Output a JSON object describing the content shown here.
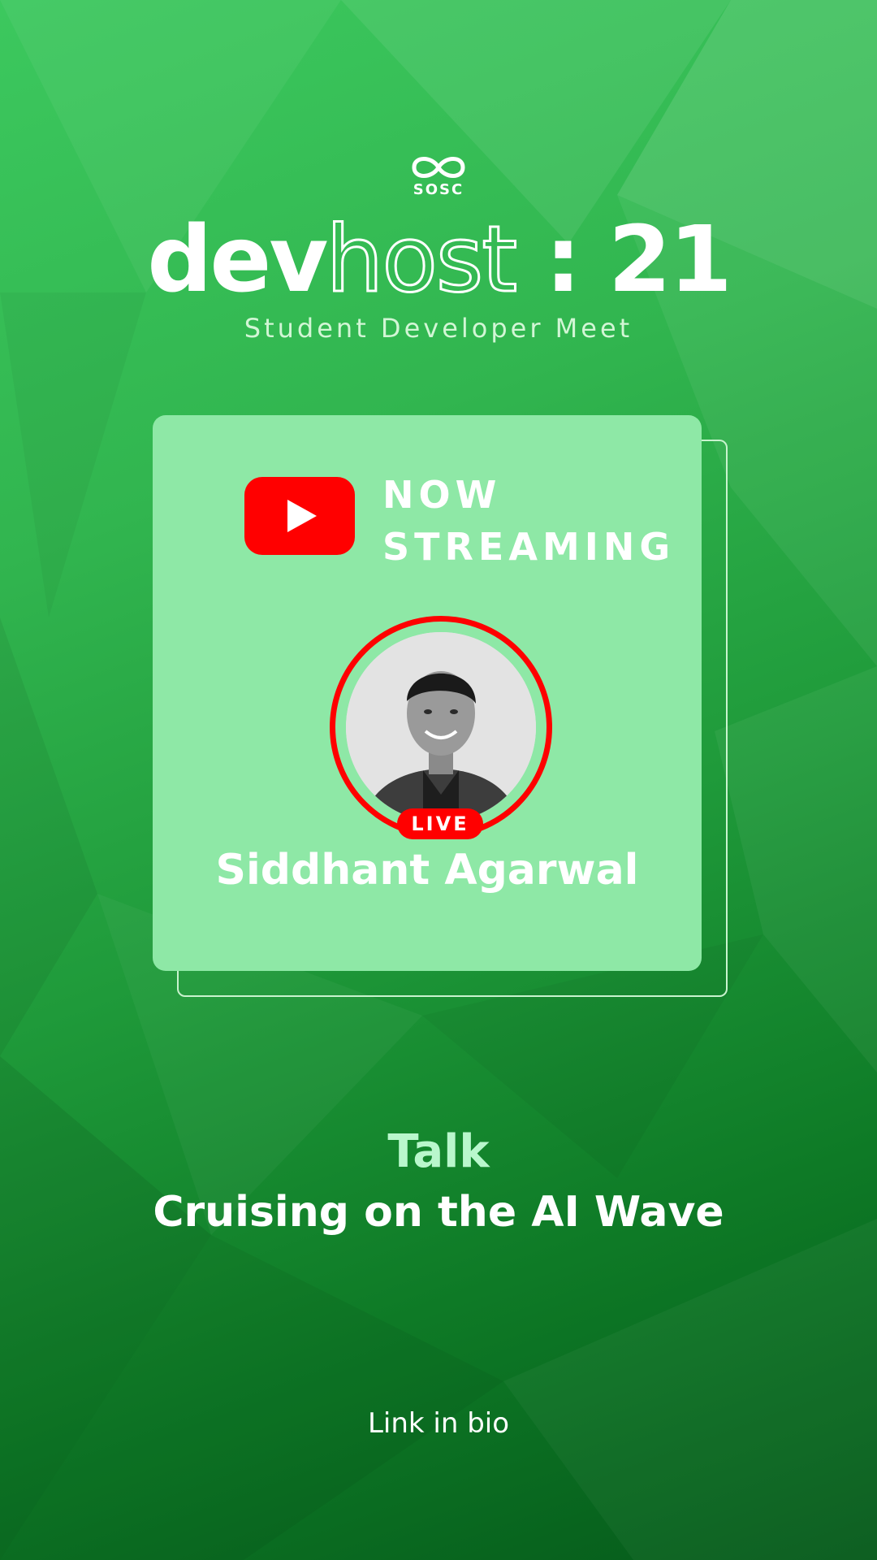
{
  "colors": {
    "background_light": "#3cc85e",
    "background_dark": "#05591a",
    "card": "#8ee8a6",
    "accent_red": "#ff0000",
    "text": "#ffffff",
    "subtitle": "#d2f6d5",
    "talk_label": "#b9f7cc"
  },
  "logo": {
    "icon": "sosc-infinity-icon",
    "text": "SOSC"
  },
  "event": {
    "title_bold": "dev",
    "title_outline": "host",
    "title_suffix": " : 21",
    "subtitle": "Student Developer Meet"
  },
  "card": {
    "stream_icon": "youtube-play-icon",
    "now_line1": "NOW",
    "now_line2": "STREAMING",
    "badge": "LIVE",
    "speaker_name": "Siddhant Agarwal"
  },
  "talk": {
    "label": "Talk",
    "title": "Cruising on the AI Wave"
  },
  "footer": {
    "link_text": "Link in bio"
  }
}
